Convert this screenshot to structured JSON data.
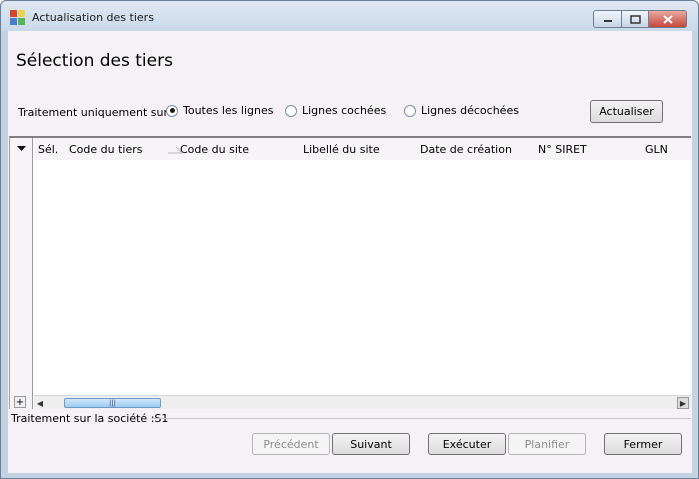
{
  "window": {
    "title": "Actualisation des tiers",
    "icon": "app-icon",
    "controls": {
      "minimize": "minimize-icon",
      "maximize": "maximize-icon",
      "close": "close-icon"
    }
  },
  "page": {
    "title": "Sélection des tiers"
  },
  "filter": {
    "label": "Traitement uniquement sur :",
    "options": [
      {
        "label": "Toutes les lignes",
        "selected": true
      },
      {
        "label": "Lignes cochées",
        "selected": false
      },
      {
        "label": "Lignes décochées",
        "selected": false
      }
    ],
    "refresh_label": "Actualiser"
  },
  "grid": {
    "columns": [
      "Sél.",
      "Code du tiers",
      "Code du site",
      "Libellé du site",
      "Date de création",
      "N° SIRET",
      "GLN"
    ],
    "sorted_column": "Code du tiers",
    "rows": [],
    "add_row_label": "+",
    "scroll_thumb_grip": "|||"
  },
  "footer": {
    "company_text": "Traitement sur la société :S1"
  },
  "buttons": {
    "previous": "Précédent",
    "next": "Suivant",
    "execute": "Exécuter",
    "schedule": "Planifier",
    "close": "Fermer"
  },
  "colors": {
    "title_bar": "#c9d8ea",
    "client_background": "#f5f1f6",
    "scroll_thumb": "#9ccbf0"
  }
}
